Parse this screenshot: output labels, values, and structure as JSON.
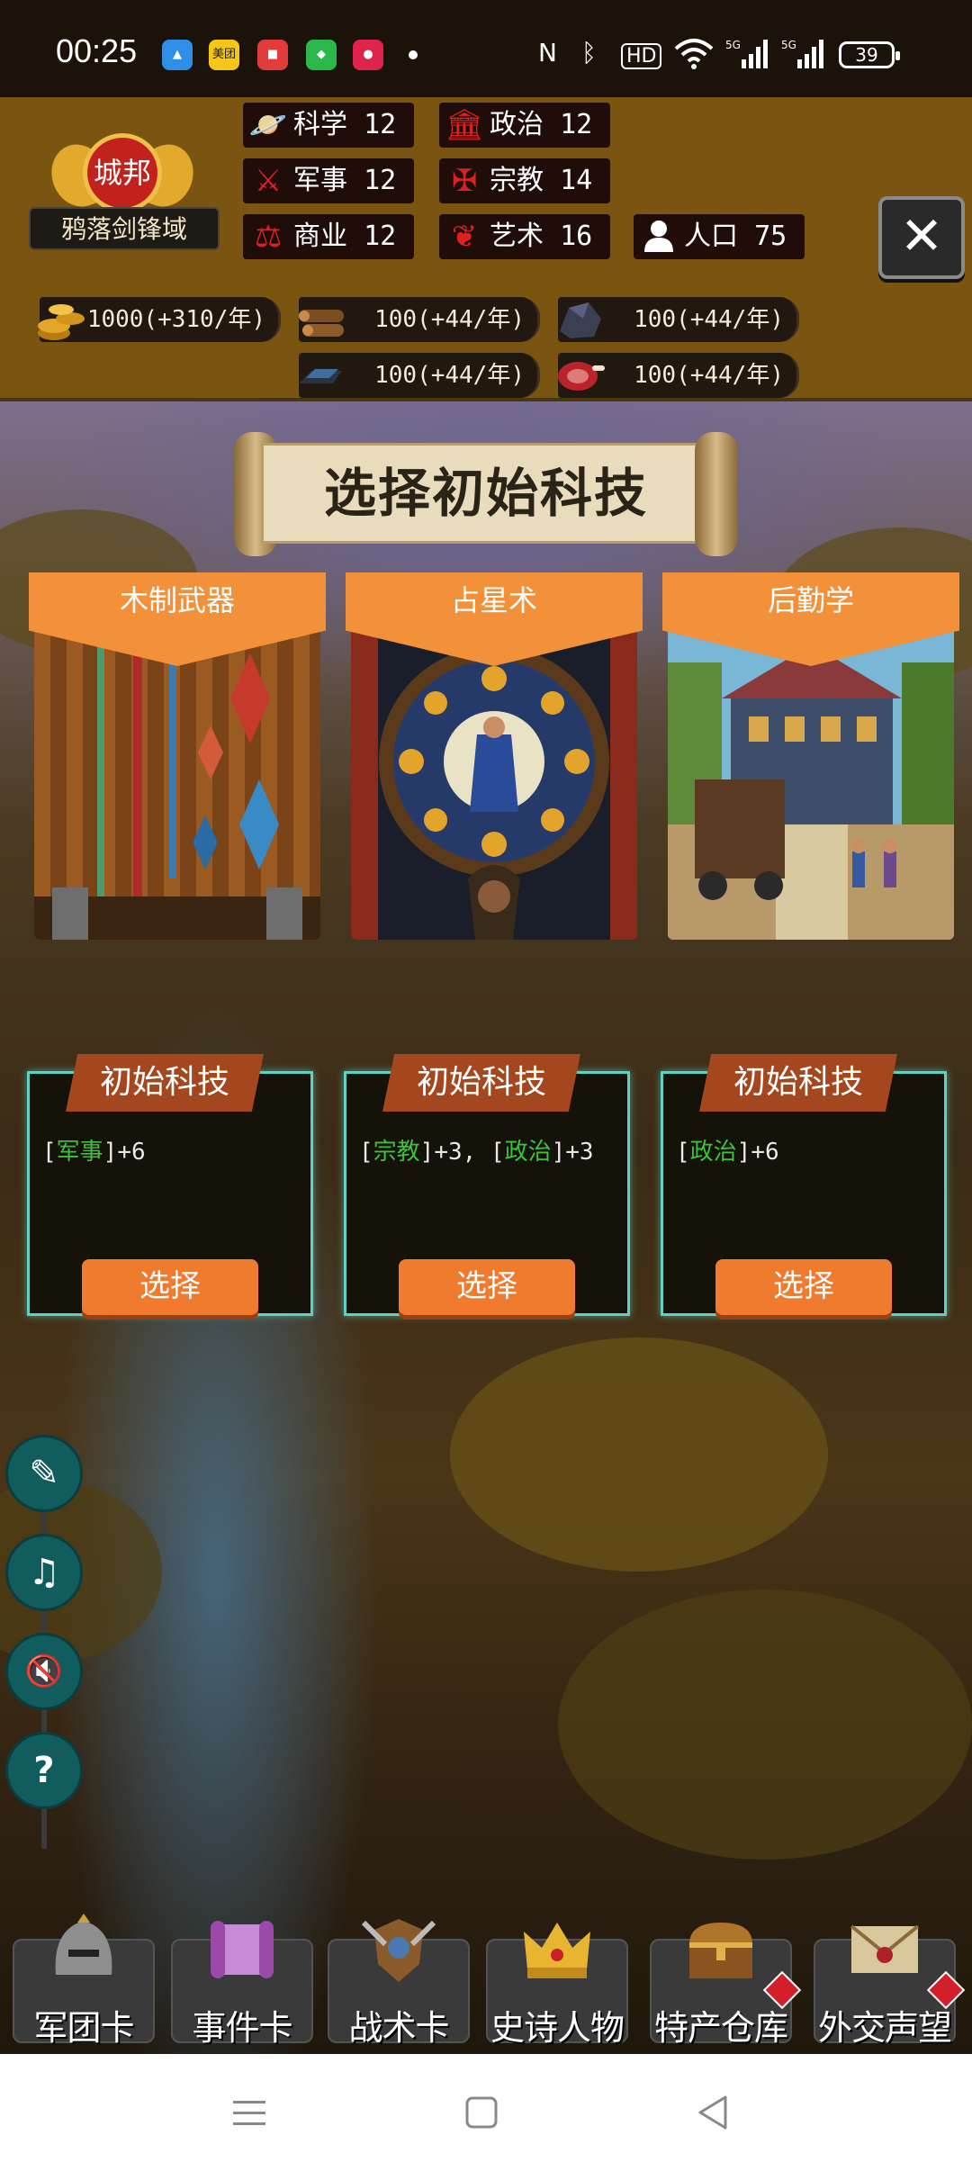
{
  "status_bar": {
    "time": "00:25",
    "app_icons": [
      {
        "name": "app-icon-1",
        "label": "",
        "color": "#2e8ee8"
      },
      {
        "name": "meituan-icon",
        "label": "美团",
        "color": "#f5c518"
      },
      {
        "name": "app-icon-3",
        "label": "",
        "color": "#e23b3b"
      },
      {
        "name": "shield-app-icon",
        "label": "",
        "color": "#2ab84a"
      },
      {
        "name": "app-icon-5",
        "label": "",
        "color": "#e0234a"
      }
    ],
    "battery": "39"
  },
  "hud": {
    "city_type": "城邦",
    "city_name": "鸦落剑锋域",
    "stats": [
      {
        "label": "科学",
        "value": "12",
        "icon": "planet-icon"
      },
      {
        "label": "政治",
        "value": "12",
        "icon": "government-icon"
      },
      {
        "label": "军事",
        "value": "12",
        "icon": "crossed-swords-icon"
      },
      {
        "label": "宗教",
        "value": "14",
        "icon": "cross-icon"
      },
      {
        "label": "商业",
        "value": "12",
        "icon": "scales-icon"
      },
      {
        "label": "艺术",
        "value": "16",
        "icon": "lotus-icon"
      },
      {
        "label": "人口",
        "value": "75",
        "icon": "person-icon"
      }
    ],
    "resources": [
      {
        "name": "gold",
        "icon": "gold-coins-icon",
        "text": "1000(+310/年)"
      },
      {
        "name": "wood",
        "icon": "wood-logs-icon",
        "text": "100(+44/年)"
      },
      {
        "name": "stone",
        "icon": "stone-ore-icon",
        "text": "100(+44/年)"
      },
      {
        "name": "iron",
        "icon": "iron-ingot-icon",
        "text": "100(+44/年)"
      },
      {
        "name": "meat",
        "icon": "meat-icon",
        "text": "100(+44/年)"
      }
    ]
  },
  "panel": {
    "title": "选择初始科技",
    "tag_label": "初始科技",
    "choose_label": "选择",
    "cards": [
      {
        "name": "木制武器",
        "effect": [
          {
            "t": "[",
            "g": false
          },
          {
            "t": "军事",
            "g": true
          },
          {
            "t": "]+6",
            "g": false
          }
        ]
      },
      {
        "name": "占星术",
        "effect": [
          {
            "t": "[",
            "g": false
          },
          {
            "t": "宗教",
            "g": true
          },
          {
            "t": "]+3, [",
            "g": false
          },
          {
            "t": "政治",
            "g": true
          },
          {
            "t": "]+3",
            "g": false
          }
        ]
      },
      {
        "name": "后勤学",
        "effect": [
          {
            "t": "[",
            "g": false
          },
          {
            "t": "政治",
            "g": true
          },
          {
            "t": "]+6",
            "g": false
          }
        ]
      }
    ]
  },
  "side_buttons": [
    {
      "name": "scroll-quill-button",
      "icon": "✎"
    },
    {
      "name": "music-off-button",
      "icon": "♫"
    },
    {
      "name": "sound-off-button",
      "icon": "🔇"
    },
    {
      "name": "help-button",
      "icon": "?"
    }
  ],
  "dock": [
    {
      "label": "军团卡",
      "icon": "helmet-icon",
      "alert": false
    },
    {
      "label": "事件卡",
      "icon": "scroll-icon",
      "alert": false
    },
    {
      "label": "战术卡",
      "icon": "shield-axes-icon",
      "alert": false
    },
    {
      "label": "史诗人物",
      "icon": "crown-icon",
      "alert": false
    },
    {
      "label": "特产仓库",
      "icon": "treasure-chest-icon",
      "alert": true
    },
    {
      "label": "外交声望",
      "icon": "sealed-letter-icon",
      "alert": true
    }
  ],
  "colors": {
    "hud_bg": "#7a5512",
    "banner_orange": "#f2913a",
    "button_orange": "#f07a2e",
    "frame_cyan": "#5fd0c4",
    "effect_green": "#3fc03a"
  }
}
